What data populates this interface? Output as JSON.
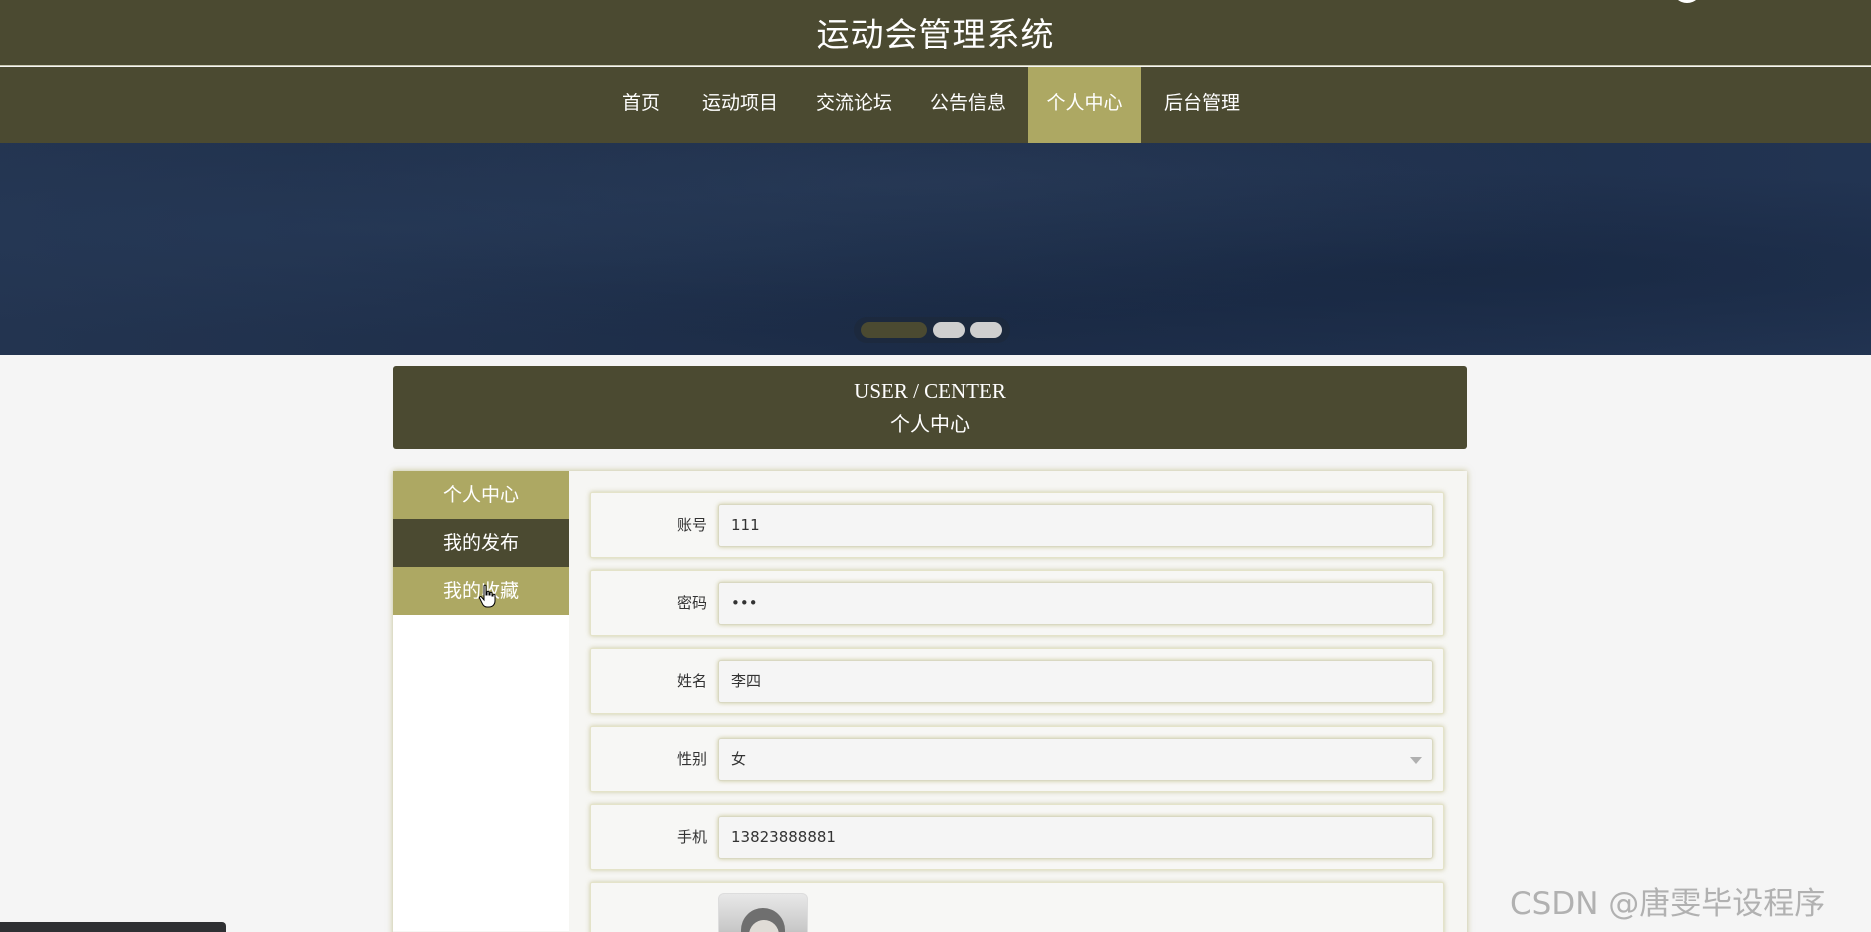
{
  "header": {
    "site_title": "运动会管理系统"
  },
  "nav": {
    "items": [
      "首页",
      "运动项目",
      "交流论坛",
      "公告信息",
      "个人中心",
      "后台管理"
    ],
    "active": "个人中心"
  },
  "banner": {
    "slide_count": 3,
    "active_slide": 1
  },
  "section_title": {
    "en": "USER / CENTER",
    "cn": "个人中心"
  },
  "sidebar": {
    "items": [
      "个人中心",
      "我的发布",
      "我的收藏"
    ]
  },
  "form": {
    "account_label": "账号",
    "account_value": "111",
    "password_label": "密码",
    "password_value": "•••",
    "name_label": "姓名",
    "name_value": "李四",
    "gender_label": "性别",
    "gender_value": "女",
    "phone_label": "手机",
    "phone_value": "13823888881"
  },
  "watermark": "CSDN @唐雯毕设程序",
  "colors": {
    "header_bg": "#4b4a31",
    "accent": "#ada863",
    "page_bg": "#f5f5f5",
    "banner_bg": "#1c2c47"
  }
}
